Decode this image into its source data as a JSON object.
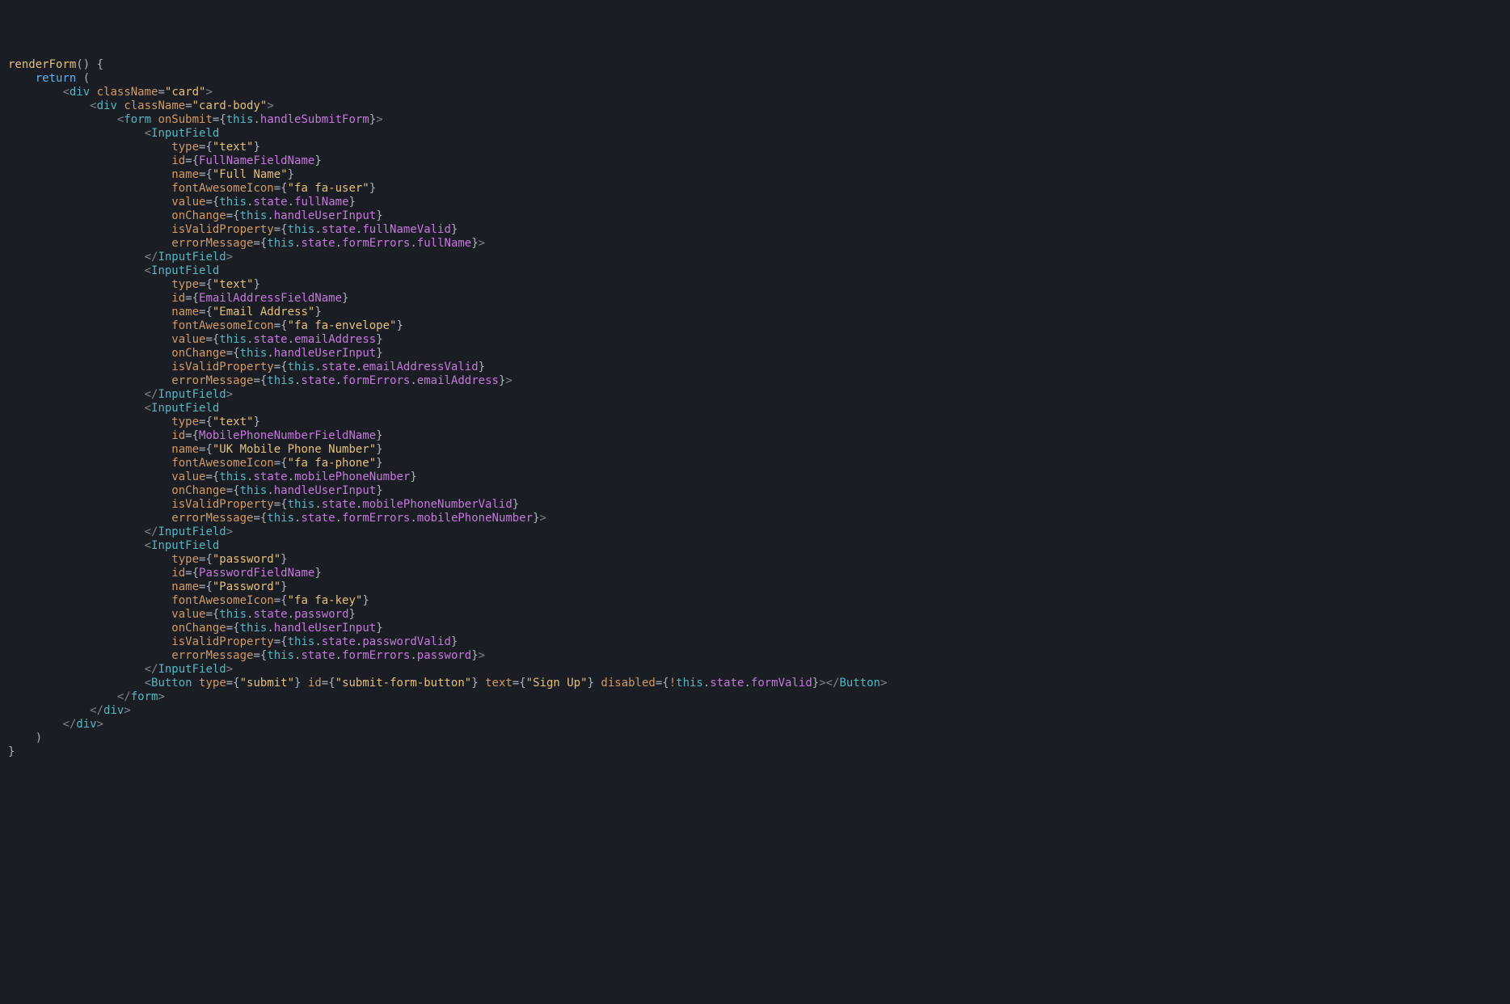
{
  "code": {
    "fn_name": "renderForm",
    "return_kw": "return",
    "div": "div",
    "form": "form",
    "InputField": "InputField",
    "Button": "Button",
    "className_attr": "className",
    "onSubmit_attr": "onSubmit",
    "type_attr": "type",
    "id_attr": "id",
    "name_attr": "name",
    "fontAwesomeIcon_attr": "fontAwesomeIcon",
    "value_attr": "value",
    "onChange_attr": "onChange",
    "isValidProperty_attr": "isValidProperty",
    "errorMessage_attr": "errorMessage",
    "text_attr": "text",
    "disabled_attr": "disabled",
    "card": "\"card\"",
    "card_body": "\"card-body\"",
    "this": "this",
    "state": "state",
    "formErrors": "formErrors",
    "handleSubmitForm": "handleSubmitForm",
    "handleUserInput": "handleUserInput",
    "fields": {
      "fullName": {
        "type": "\"text\"",
        "id": "FullNameFieldName",
        "name": "\"Full Name\"",
        "icon": "\"fa fa-user\"",
        "value": "fullName",
        "valid": "fullNameValid",
        "err": "fullName"
      },
      "email": {
        "type": "\"text\"",
        "id": "EmailAddressFieldName",
        "name": "\"Email Address\"",
        "icon": "\"fa fa-envelope\"",
        "value": "emailAddress",
        "valid": "emailAddressValid",
        "err": "emailAddress"
      },
      "phone": {
        "type": "\"text\"",
        "id": "MobilePhoneNumberFieldName",
        "name": "\"UK Mobile Phone Number\"",
        "icon": "\"fa fa-phone\"",
        "value": "mobilePhoneNumber",
        "valid": "mobilePhoneNumberValid",
        "err": "mobilePhoneNumber"
      },
      "password": {
        "type": "\"password\"",
        "id": "PasswordFieldName",
        "name": "\"Password\"",
        "icon": "\"fa fa-key\"",
        "value": "password",
        "valid": "passwordValid",
        "err": "password"
      }
    },
    "button": {
      "type": "\"submit\"",
      "id": "\"submit-form-button\"",
      "text": "\"Sign Up\"",
      "formValid": "formValid"
    }
  }
}
